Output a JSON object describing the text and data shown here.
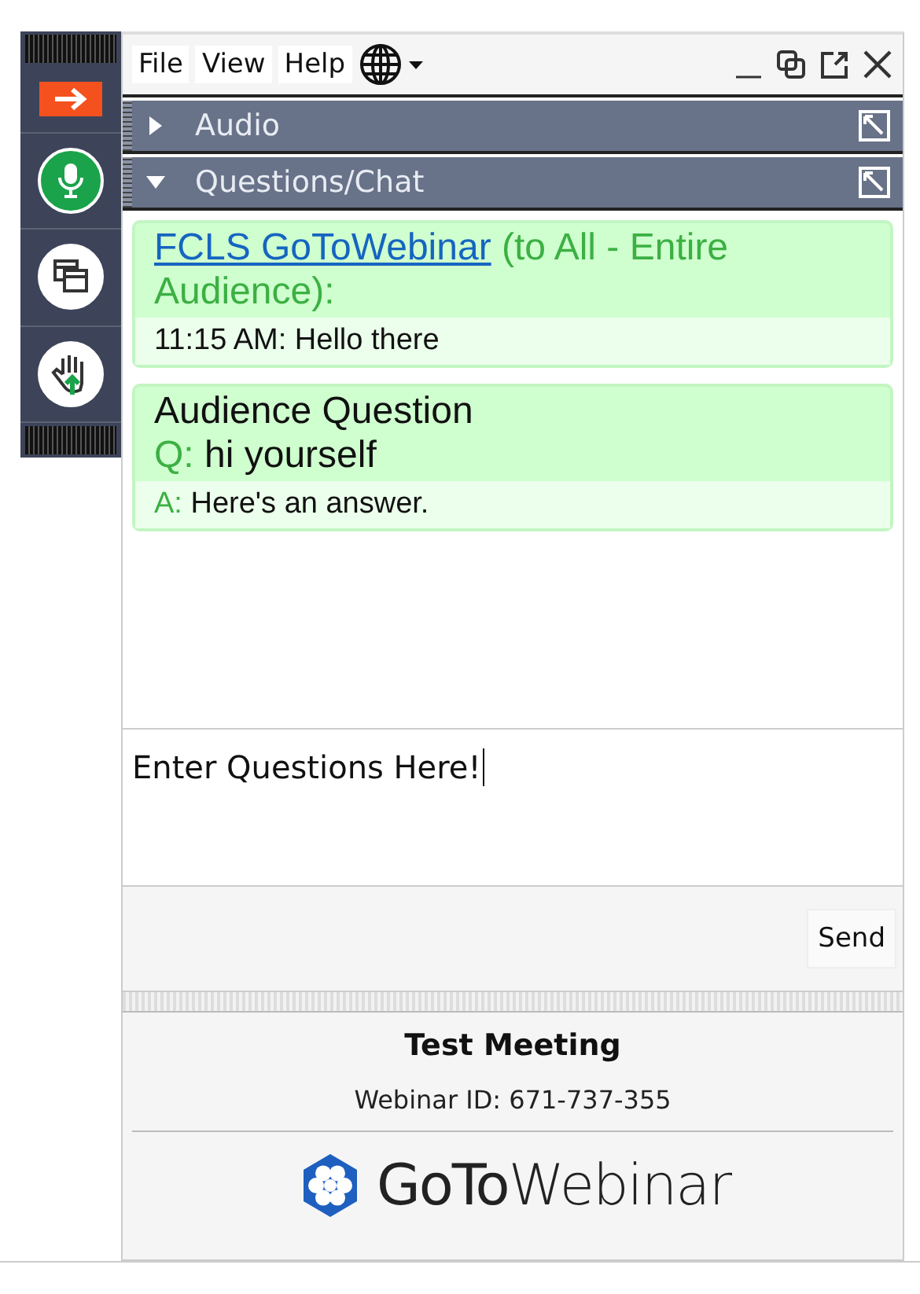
{
  "menu": [
    "File",
    "View",
    "Help"
  ],
  "toolbar": {
    "mic_on": true
  },
  "sections": [
    {
      "label": "Audio",
      "expanded": false
    },
    {
      "label": "Questions/Chat",
      "expanded": true
    }
  ],
  "messages": [
    {
      "kind": "message",
      "sender": "FCLS GoToWebinar",
      "recipient": "(to All - Entire Audience):",
      "body": "11:15 AM: Hello there"
    },
    {
      "kind": "question",
      "title": "Audience Question",
      "q_label": "Q:",
      "question": "hi yourself",
      "a_label": "A:",
      "answer": "Here's an answer."
    }
  ],
  "input": {
    "value": "Enter Questions Here!"
  },
  "send_button": "Send",
  "footer": {
    "title": "Test Meeting",
    "webinar_id": "Webinar ID: 671-737-355",
    "logo": "**GoTo**Webinar"
  }
}
